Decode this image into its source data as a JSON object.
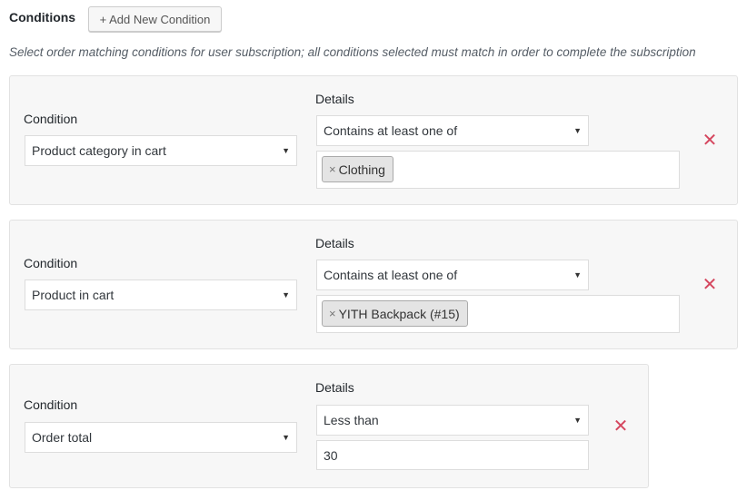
{
  "header": {
    "title": "Conditions",
    "add_button_label": "+ Add New Condition",
    "description": "Select order matching conditions for user subscription; all conditions selected must match in order to complete the subscription"
  },
  "conditions": [
    {
      "condition_label": "Condition",
      "condition_value": "Product category in cart",
      "details_label": "Details",
      "details_operator": "Contains at least one of",
      "selected_items": [
        "Clothing"
      ]
    },
    {
      "condition_label": "Condition",
      "condition_value": "Product in cart",
      "details_label": "Details",
      "details_operator": "Contains at least one of",
      "selected_items": [
        "YITH Backpack (#15)"
      ]
    },
    {
      "condition_label": "Condition",
      "condition_value": "Order total",
      "details_label": "Details",
      "details_operator": "Less than",
      "value_input": "30"
    }
  ],
  "icons": {
    "dropdown": "caret-down-icon",
    "remove_chip": "close-icon",
    "delete_condition": "delete-icon"
  },
  "colors": {
    "delete_icon": "#d5475f",
    "card_background": "#f7f7f7",
    "chip_background": "#e4e4e4"
  }
}
